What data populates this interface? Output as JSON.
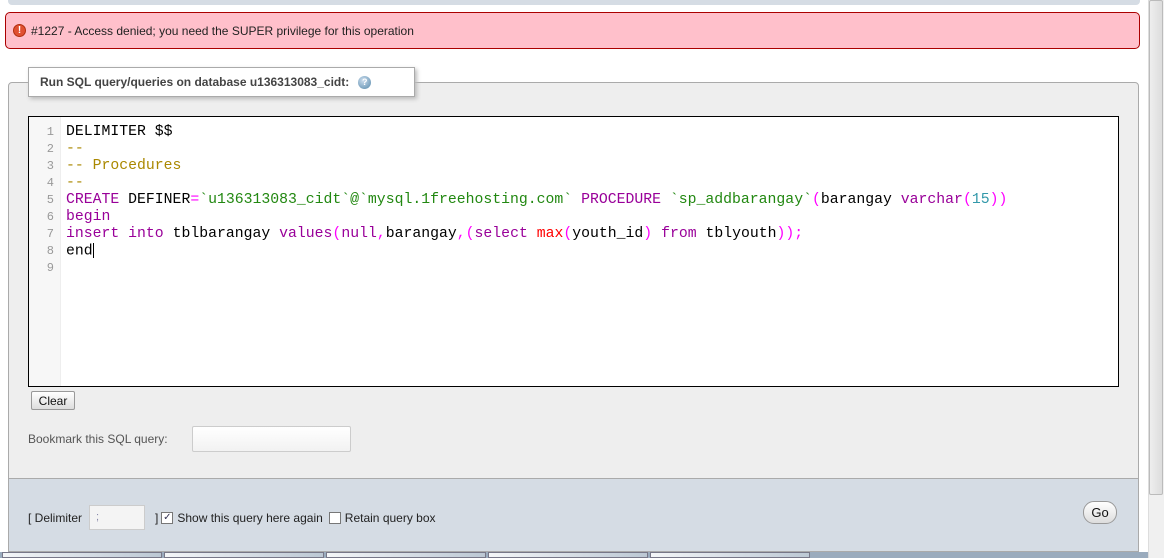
{
  "error": {
    "icon": "error-icon",
    "message": "#1227 - Access denied; you need the SUPER privilege for this operation"
  },
  "query_box": {
    "legend": "Run SQL query/queries on database u136313083_cidt:",
    "help_icon": "help-icon",
    "line_numbers": [
      "1",
      "2",
      "3",
      "4",
      "5",
      "6",
      "7",
      "8",
      "9"
    ],
    "lines": [
      [
        [
          "tx",
          "DELIMITER $$"
        ]
      ],
      [
        [
          "cm",
          "--"
        ]
      ],
      [
        [
          "cm",
          "-- Procedures"
        ]
      ],
      [
        [
          "cm",
          "--"
        ]
      ],
      [
        [
          "kw",
          "CREATE"
        ],
        [
          "tx",
          " DEFINER"
        ],
        [
          "pn",
          "="
        ],
        [
          "str",
          "`u136313083_cidt`@`mysql.1freehosting.com`"
        ],
        [
          "tx",
          " "
        ],
        [
          "kw",
          "PROCEDURE"
        ],
        [
          "tx",
          " "
        ],
        [
          "str",
          "`sp_addbarangay`"
        ],
        [
          "pn",
          "("
        ],
        [
          "tx",
          "barangay "
        ],
        [
          "kw",
          "varchar"
        ],
        [
          "pn",
          "("
        ],
        [
          "num",
          "15"
        ],
        [
          "pn",
          "))"
        ]
      ],
      [
        [
          "kw",
          "begin"
        ]
      ],
      [
        [
          "kw",
          "insert"
        ],
        [
          "tx",
          " "
        ],
        [
          "kw",
          "into"
        ],
        [
          "tx",
          " tblbarangay "
        ],
        [
          "kw",
          "values"
        ],
        [
          "pn",
          "("
        ],
        [
          "kw",
          "null"
        ],
        [
          "pn",
          ","
        ],
        [
          "tx",
          "barangay"
        ],
        [
          "pn",
          ",("
        ],
        [
          "kw",
          "select"
        ],
        [
          "tx",
          " "
        ],
        [
          "fn",
          "max"
        ],
        [
          "pn",
          "("
        ],
        [
          "tx",
          "youth_id"
        ],
        [
          "pn",
          ")"
        ],
        [
          "tx",
          " "
        ],
        [
          "kw",
          "from"
        ],
        [
          "tx",
          " tblyouth"
        ],
        [
          "pn",
          "));"
        ]
      ],
      [
        [
          "tx",
          "end"
        ]
      ],
      []
    ],
    "clear_label": "Clear",
    "bookmark_label": "Bookmark this SQL query:",
    "bookmark_value": ""
  },
  "footer": {
    "delimiter_open": "[ Delimiter",
    "delimiter_value": ";",
    "delimiter_close": "]",
    "show_query_label": "Show this query here again",
    "show_query_checked": true,
    "retain_label": "Retain query box",
    "retain_checked": false,
    "go_label": "Go"
  }
}
